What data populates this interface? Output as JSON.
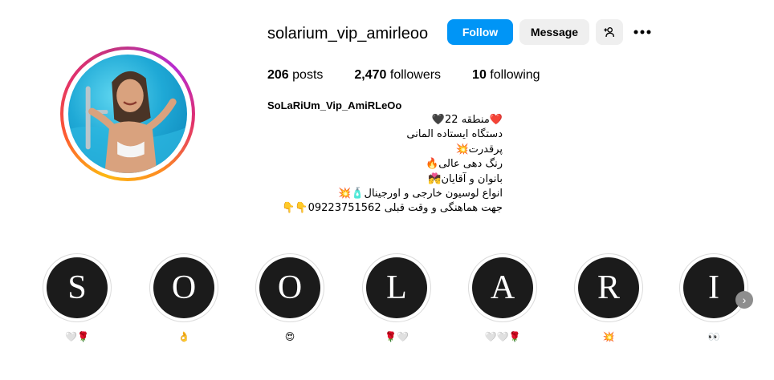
{
  "profile": {
    "username": "solarium_vip_amirleoo",
    "full_name": "SoLaRiUm_Vip_AmiRLeOo",
    "avatar": "profile-photo",
    "bio": "❤️منطقه 22🖤\nدستگاه ایستاده المانی\nپرقدرت💥\nرنگ دهی عالی🔥\nبانوان و آقایان💏\nانواع لوسیون خارجی و اورجینال🧴💥\nجهت هماهنگی و وقت قبلی 09223751562👇👇"
  },
  "actions": {
    "follow_label": "Follow",
    "message_label": "Message",
    "add_user_icon": "add-user-icon",
    "more_icon": "more-options-icon"
  },
  "stats": {
    "posts_count": "206",
    "posts_label": "posts",
    "followers_count": "2,470",
    "followers_label": "followers",
    "following_count": "10",
    "following_label": "following"
  },
  "highlights": [
    {
      "letter": "S",
      "label": "🤍🌹"
    },
    {
      "letter": "O",
      "label": "👌"
    },
    {
      "letter": "O",
      "label": "😍"
    },
    {
      "letter": "L",
      "label": "🌹🤍"
    },
    {
      "letter": "A",
      "label": "🤍🤍🌹"
    },
    {
      "letter": "R",
      "label": "💥"
    },
    {
      "letter": "I",
      "label": "👀"
    }
  ],
  "colors": {
    "follow_button": "#0095f6",
    "secondary_button": "#efefef",
    "highlight_circle": "#1b1b1b"
  }
}
